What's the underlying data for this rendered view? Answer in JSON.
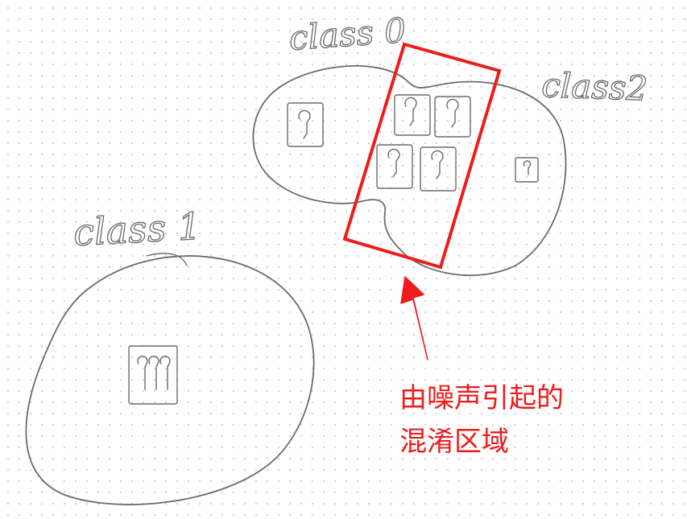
{
  "labels": {
    "class0": "class 0",
    "class1": "class 1",
    "class2": "class2"
  },
  "annotation": {
    "line1": "由噪声引起的",
    "line2": "混淆区域"
  },
  "colors": {
    "ink": "#6b6b6b",
    "highlight": "#ee1c1c",
    "dots": "#cfcfcf"
  }
}
